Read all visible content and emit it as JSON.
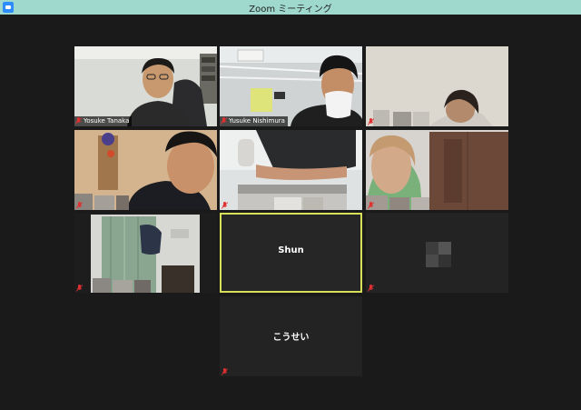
{
  "window": {
    "title": "Zoom ミーティング"
  },
  "participants": [
    {
      "name": "Yosuke Tanaka",
      "video": true,
      "muted": true
    },
    {
      "name": "Yusuke Nishimura",
      "video": true,
      "muted": true
    },
    {
      "name": "",
      "video": true,
      "muted": true
    },
    {
      "name": "",
      "video": true,
      "muted": true
    },
    {
      "name": "",
      "video": true,
      "muted": true
    },
    {
      "name": "",
      "video": true,
      "muted": true
    },
    {
      "name": "",
      "video": true,
      "muted": true
    },
    {
      "name": "Shun",
      "video": false,
      "muted": false,
      "speaking": true
    },
    {
      "name": "",
      "video": false,
      "muted": true
    },
    {
      "name": "こうせい",
      "video": false,
      "muted": true
    }
  ],
  "colors": {
    "titlebar": "#9fd8cc",
    "stage": "#1a1a1a",
    "active_speaker": "#d8e05a",
    "muted": "#e03030"
  }
}
